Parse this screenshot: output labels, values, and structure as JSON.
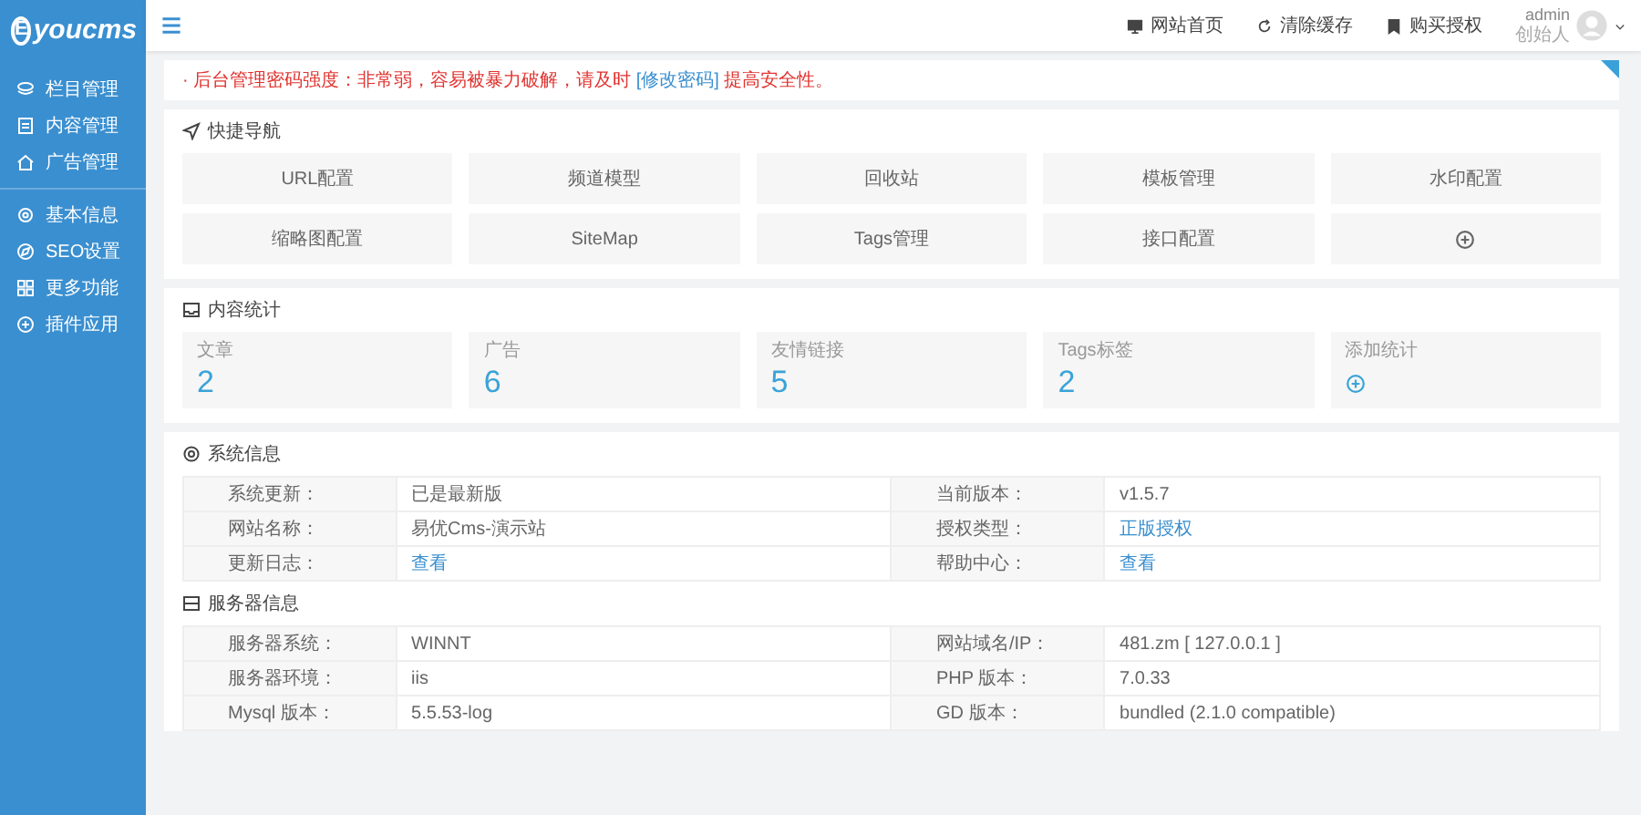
{
  "sidebar": {
    "logo_mark": "E",
    "logo_text": "youcms",
    "groups": [
      [
        {
          "label": "栏目管理"
        },
        {
          "label": "内容管理"
        },
        {
          "label": "广告管理"
        }
      ],
      [
        {
          "label": "基本信息"
        },
        {
          "label": "SEO设置"
        },
        {
          "label": "更多功能"
        },
        {
          "label": "插件应用"
        }
      ]
    ]
  },
  "top_bar": {
    "links": [
      {
        "label": "网站首页"
      },
      {
        "label": "清除缓存"
      },
      {
        "label": "购买授权"
      }
    ],
    "user": {
      "name": "admin",
      "role": "创始人"
    }
  },
  "notice": {
    "before": "· 后台管理密码强度：非常弱，容易被暴力破解，请及时",
    "link": "[修改密码]",
    "after": "提高安全性。"
  },
  "quick_nav": {
    "title": "快捷导航",
    "items": [
      {
        "kind": "text",
        "label": "URL配置"
      },
      {
        "kind": "text",
        "label": "频道模型"
      },
      {
        "kind": "text",
        "label": "回收站"
      },
      {
        "kind": "text",
        "label": "模板管理"
      },
      {
        "kind": "text",
        "label": "水印配置"
      },
      {
        "kind": "text",
        "label": "缩略图配置"
      },
      {
        "kind": "text",
        "label": "SiteMap"
      },
      {
        "kind": "text",
        "label": "Tags管理"
      },
      {
        "kind": "text",
        "label": "接口配置"
      },
      {
        "kind": "add"
      }
    ]
  },
  "content_stats": {
    "title": "内容统计",
    "items": [
      {
        "kind": "count",
        "label": "文章",
        "value": "2"
      },
      {
        "kind": "count",
        "label": "广告",
        "value": "6"
      },
      {
        "kind": "count",
        "label": "友情链接",
        "value": "5"
      },
      {
        "kind": "count",
        "label": "Tags标签",
        "value": "2"
      },
      {
        "kind": "add",
        "label": "添加统计"
      }
    ]
  },
  "system_info": {
    "title": "系统信息",
    "rows": [
      [
        {
          "label": "系统更新：",
          "value": "已是最新版",
          "kind": "text"
        },
        {
          "label": "当前版本：",
          "value": "v1.5.7",
          "kind": "text"
        }
      ],
      [
        {
          "label": "网站名称：",
          "value": "易优Cms-演示站",
          "kind": "text"
        },
        {
          "label": "授权类型：",
          "value": "正版授权",
          "kind": "link"
        }
      ],
      [
        {
          "label": "更新日志：",
          "value": "查看",
          "kind": "link"
        },
        {
          "label": "帮助中心：",
          "value": "查看",
          "kind": "link"
        }
      ]
    ]
  },
  "server_info": {
    "title": "服务器信息",
    "rows": [
      [
        {
          "label": "服务器系统：",
          "value": "WINNT",
          "kind": "text"
        },
        {
          "label": "网站域名/IP：",
          "value": "481.zm [ 127.0.0.1 ]",
          "kind": "text"
        }
      ],
      [
        {
          "label": "服务器环境：",
          "value": "iis",
          "kind": "text"
        },
        {
          "label": "PHP 版本：",
          "value": "7.0.33",
          "kind": "text"
        }
      ],
      [
        {
          "label": "Mysql 版本：",
          "value": "5.5.53-log",
          "kind": "text"
        },
        {
          "label": "GD 版本：",
          "value": "bundled (2.1.0 compatible)",
          "kind": "text"
        }
      ]
    ]
  }
}
